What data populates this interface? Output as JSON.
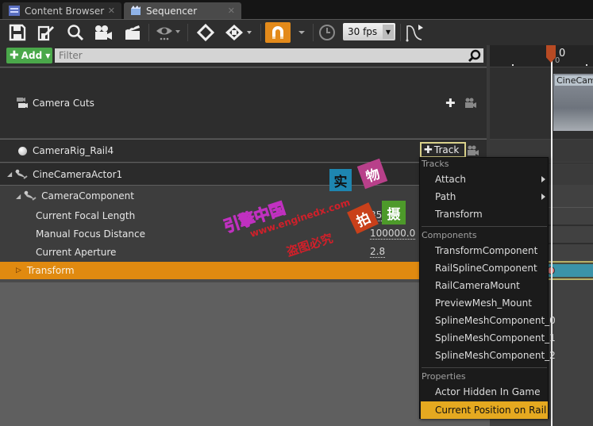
{
  "tabs": [
    {
      "label": "Content Browser",
      "active": false,
      "icon": "content-browser-icon"
    },
    {
      "label": "Sequencer",
      "active": true,
      "icon": "sequencer-icon"
    }
  ],
  "toolbar": {
    "buttons": [
      "save-icon",
      "save-as-icon",
      "find-icon",
      "camera-icon",
      "render-movie-icon",
      "view-options-icon",
      "key-icon",
      "transform-key-icon",
      "snap-magnet-icon",
      "time-icon",
      "curve-editor-icon"
    ],
    "fps": "30 fps"
  },
  "outliner": {
    "add_label": "Add",
    "filter_placeholder": "Filter",
    "rows": {
      "camera_cuts": "Camera Cuts",
      "rig": "CameraRig_Rail4",
      "actor": "CineCameraActor1",
      "component": "CameraComponent",
      "props": [
        {
          "label": "Current Focal Length",
          "value": "35."
        },
        {
          "label": "Manual Focus Distance",
          "value": "100000.0"
        },
        {
          "label": "Current Aperture",
          "value": "2.8"
        }
      ],
      "transform": "Transform"
    },
    "track_button": "Track"
  },
  "timeline": {
    "current_frame": "0",
    "current_frame_sub": "0",
    "shot_label": "CineCam"
  },
  "track_menu": {
    "sections": [
      {
        "header": "Tracks",
        "items": [
          {
            "label": "Attach",
            "submenu": true
          },
          {
            "label": "Path",
            "submenu": true
          },
          {
            "label": "Transform",
            "submenu": false
          }
        ]
      },
      {
        "header": "Components",
        "items": [
          {
            "label": "TransformComponent"
          },
          {
            "label": "RailSplineComponent"
          },
          {
            "label": "RailCameraMount"
          },
          {
            "label": "PreviewMesh_Mount"
          },
          {
            "label": "SplineMeshComponent_0"
          },
          {
            "label": "SplineMeshComponent_1"
          },
          {
            "label": "SplineMeshComponent_2"
          }
        ]
      },
      {
        "header": "Properties",
        "items": [
          {
            "label": "Actor Hidden In Game"
          },
          {
            "label": "Current Position on Rail",
            "selected": true
          }
        ]
      }
    ]
  },
  "watermark": {
    "site": "www.enginedx.com",
    "brand": "引擎中国",
    "notice": "盗图必究",
    "stamps": [
      "实",
      "物",
      "拍",
      "摄"
    ]
  },
  "colors": {
    "accent_orange": "#e08a10",
    "menu_highlight": "#e5a920",
    "add_green": "#4aa84a",
    "playhead": "#b84a23"
  }
}
